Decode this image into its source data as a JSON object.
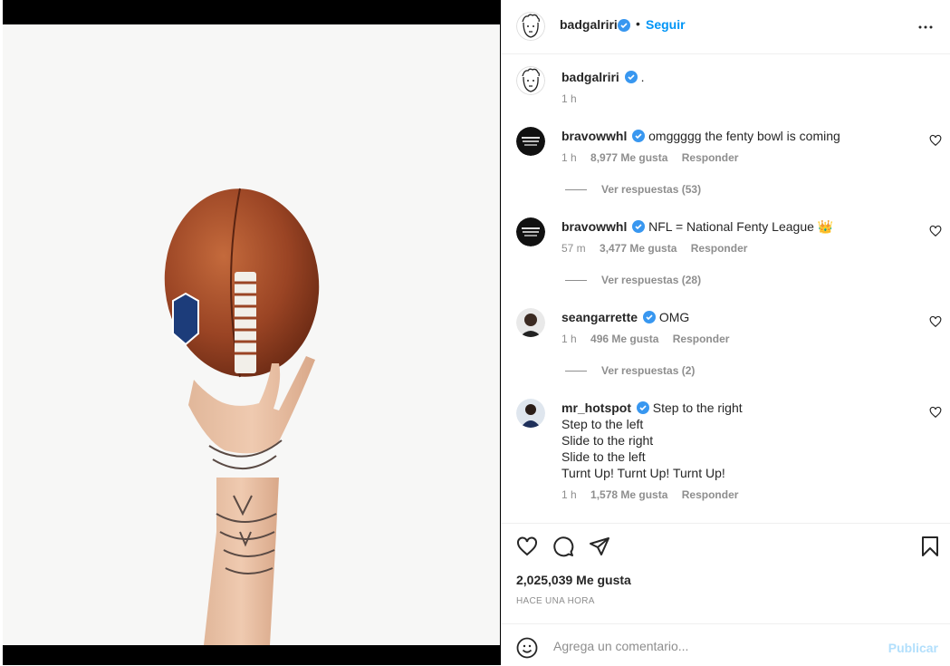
{
  "post": {
    "author": "badgalriri",
    "follow_label": "Seguir",
    "dot": "•",
    "caption": ".",
    "caption_time": "1 h",
    "likes": "2,025,039 Me gusta",
    "posted": "HACE UNA HORA"
  },
  "comments": [
    {
      "user": "bravowwhl",
      "text": "omggggg the fenty bowl is coming",
      "time": "1 h",
      "likes": "8,977 Me gusta",
      "reply": "Responder",
      "replies": "Ver respuestas (53)"
    },
    {
      "user": "bravowwhl",
      "text": "NFL = National Fenty League",
      "emoji": "👑",
      "time": "57 m",
      "likes": "3,477 Me gusta",
      "reply": "Responder",
      "replies": "Ver respuestas (28)"
    },
    {
      "user": "seangarrette",
      "text": "OMG",
      "time": "1 h",
      "likes": "496 Me gusta",
      "reply": "Responder",
      "replies": "Ver respuestas (2)"
    },
    {
      "user": "mr_hotspot",
      "text": "Step to the right",
      "lines": [
        "Step to the left",
        "Slide to the right",
        "Slide to the left",
        "Turnt Up! Turnt Up! Turnt Up!"
      ],
      "time": "1 h",
      "likes": "1,578 Me gusta",
      "reply": "Responder"
    }
  ],
  "composer": {
    "placeholder": "Agrega un comentario...",
    "publish_label": "Publicar"
  },
  "colors": {
    "accent": "#0095f6",
    "verified": "#3897f0",
    "muted": "#8e8e8e"
  },
  "icons": [
    "more-options-icon",
    "verified-icon",
    "heart-icon",
    "comment-icon",
    "share-icon",
    "save-icon",
    "emoji-icon"
  ]
}
